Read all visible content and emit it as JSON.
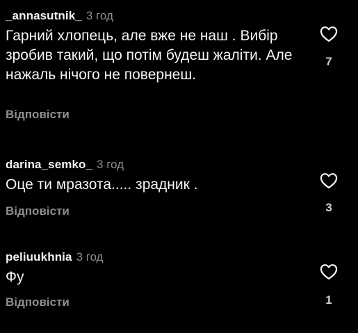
{
  "comments": [
    {
      "username": "_annasutnik_",
      "time": "3 год",
      "text": "Гарний хлопець, але вже не наш . Вибір зробив такий, що потім будеш жаліти. Але нажаль нічого не повернеш.",
      "reply_label": "Відповісти",
      "like_count": "7",
      "like_icon": "heart-outline-icon"
    },
    {
      "username": "darina_semko_",
      "time": "3 год",
      "text": "Оце ти мразота..... зрадник .",
      "reply_label": "Відповісти",
      "like_count": "3",
      "like_icon": "heart-outline-icon"
    },
    {
      "username": "peliuukhnia",
      "time": "3 год",
      "text": "Фу",
      "reply_label": "Відповісти",
      "like_count": "1",
      "like_icon": "heart-outline-icon"
    }
  ],
  "colors": {
    "background": "#000000",
    "primary_text": "#f5f5f5",
    "secondary_text": "#8e8e8e"
  }
}
